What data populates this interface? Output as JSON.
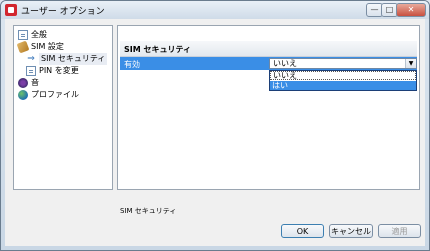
{
  "window": {
    "title": "ユーザー オプション",
    "buttons": {
      "minimize": "—",
      "maximize": "□",
      "close": "✕"
    }
  },
  "tree": {
    "items": [
      {
        "label": "全般",
        "icon": "document-icon"
      },
      {
        "label": "SIM 設定",
        "icon": "sim-card-icon"
      },
      {
        "label": "SIM セキュリティ",
        "icon": "arrow-right-icon",
        "selected": true
      },
      {
        "label": "PIN を変更",
        "icon": "document-icon"
      },
      {
        "label": "音",
        "icon": "audio-icon"
      },
      {
        "label": "プロファイル",
        "icon": "profile-icon"
      }
    ]
  },
  "panel": {
    "header": "SIM セキュリティ",
    "row_label": "有効",
    "select_value": "いいえ",
    "options": [
      "いいえ",
      "はい"
    ]
  },
  "description": "SIM セキュリティ",
  "buttons": {
    "ok": "OK",
    "cancel": "キャンセル",
    "apply": "適用"
  },
  "colors": {
    "selection": "#3a8ee6",
    "close_button": "#c85040"
  }
}
